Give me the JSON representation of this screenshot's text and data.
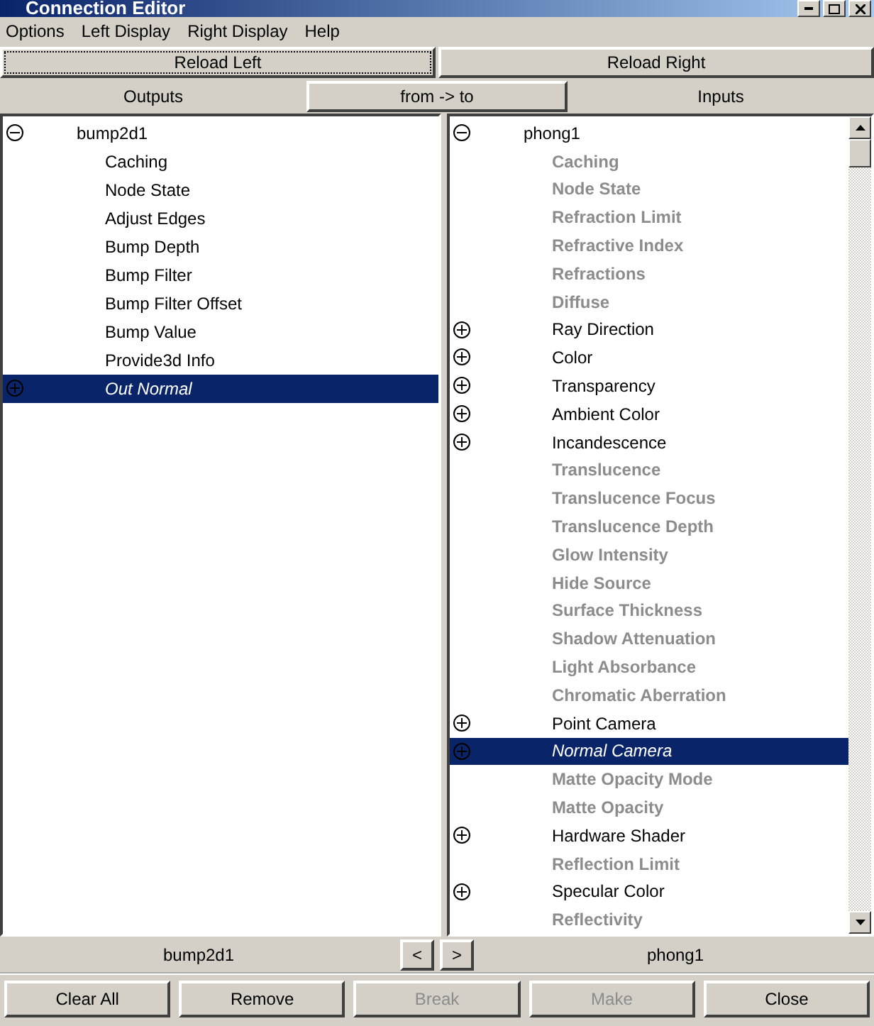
{
  "window": {
    "title": "Connection Editor"
  },
  "menu": [
    "Options",
    "Left Display",
    "Right Display",
    "Help"
  ],
  "reload": [
    {
      "label": "Reload Left",
      "focused": true
    },
    {
      "label": "Reload Right",
      "focused": false
    }
  ],
  "header": {
    "left": "Outputs",
    "toggle": "from -> to",
    "right": "Inputs"
  },
  "left_list": {
    "node": "bump2d1",
    "expanded": true,
    "children": [
      {
        "label": "Caching",
        "expandable": false,
        "dimmed": false,
        "selected": false
      },
      {
        "label": "Node State",
        "expandable": false,
        "dimmed": false,
        "selected": false
      },
      {
        "label": "Adjust Edges",
        "expandable": false,
        "dimmed": false,
        "selected": false
      },
      {
        "label": "Bump Depth",
        "expandable": false,
        "dimmed": false,
        "selected": false
      },
      {
        "label": "Bump Filter",
        "expandable": false,
        "dimmed": false,
        "selected": false
      },
      {
        "label": "Bump Filter Offset",
        "expandable": false,
        "dimmed": false,
        "selected": false
      },
      {
        "label": "Bump Value",
        "expandable": false,
        "dimmed": false,
        "selected": false
      },
      {
        "label": "Provide3d Info",
        "expandable": false,
        "dimmed": false,
        "selected": false
      },
      {
        "label": "Out Normal",
        "expandable": true,
        "dimmed": false,
        "selected": true
      }
    ]
  },
  "right_list": {
    "node": "phong1",
    "expanded": true,
    "children": [
      {
        "label": "Caching",
        "expandable": false,
        "dimmed": true,
        "selected": false
      },
      {
        "label": "Node State",
        "expandable": false,
        "dimmed": true,
        "selected": false
      },
      {
        "label": "Refraction Limit",
        "expandable": false,
        "dimmed": true,
        "selected": false
      },
      {
        "label": "Refractive Index",
        "expandable": false,
        "dimmed": true,
        "selected": false
      },
      {
        "label": "Refractions",
        "expandable": false,
        "dimmed": true,
        "selected": false
      },
      {
        "label": "Diffuse",
        "expandable": false,
        "dimmed": true,
        "selected": false
      },
      {
        "label": "Ray Direction",
        "expandable": true,
        "dimmed": false,
        "selected": false
      },
      {
        "label": "Color",
        "expandable": true,
        "dimmed": false,
        "selected": false
      },
      {
        "label": "Transparency",
        "expandable": true,
        "dimmed": false,
        "selected": false
      },
      {
        "label": "Ambient Color",
        "expandable": true,
        "dimmed": false,
        "selected": false
      },
      {
        "label": "Incandescence",
        "expandable": true,
        "dimmed": false,
        "selected": false
      },
      {
        "label": "Translucence",
        "expandable": false,
        "dimmed": true,
        "selected": false
      },
      {
        "label": "Translucence Focus",
        "expandable": false,
        "dimmed": true,
        "selected": false
      },
      {
        "label": "Translucence Depth",
        "expandable": false,
        "dimmed": true,
        "selected": false
      },
      {
        "label": "Glow Intensity",
        "expandable": false,
        "dimmed": true,
        "selected": false
      },
      {
        "label": "Hide Source",
        "expandable": false,
        "dimmed": true,
        "selected": false
      },
      {
        "label": "Surface Thickness",
        "expandable": false,
        "dimmed": true,
        "selected": false
      },
      {
        "label": "Shadow Attenuation",
        "expandable": false,
        "dimmed": true,
        "selected": false
      },
      {
        "label": "Light Absorbance",
        "expandable": false,
        "dimmed": true,
        "selected": false
      },
      {
        "label": "Chromatic Aberration",
        "expandable": false,
        "dimmed": true,
        "selected": false
      },
      {
        "label": "Point Camera",
        "expandable": true,
        "dimmed": false,
        "selected": false
      },
      {
        "label": "Normal Camera",
        "expandable": true,
        "dimmed": false,
        "selected": true
      },
      {
        "label": "Matte Opacity Mode",
        "expandable": false,
        "dimmed": true,
        "selected": false
      },
      {
        "label": "Matte Opacity",
        "expandable": false,
        "dimmed": true,
        "selected": false
      },
      {
        "label": "Hardware Shader",
        "expandable": true,
        "dimmed": false,
        "selected": false
      },
      {
        "label": "Reflection Limit",
        "expandable": false,
        "dimmed": true,
        "selected": false
      },
      {
        "label": "Specular Color",
        "expandable": true,
        "dimmed": false,
        "selected": false
      },
      {
        "label": "Reflectivity",
        "expandable": false,
        "dimmed": true,
        "selected": false
      }
    ]
  },
  "footer": {
    "left_node": "bump2d1",
    "prev": "<",
    "next": ">",
    "right_node": "phong1"
  },
  "buttons": [
    {
      "label": "Clear All",
      "disabled": false
    },
    {
      "label": "Remove",
      "disabled": false
    },
    {
      "label": "Break",
      "disabled": true
    },
    {
      "label": "Make",
      "disabled": true
    },
    {
      "label": "Close",
      "disabled": false
    }
  ]
}
